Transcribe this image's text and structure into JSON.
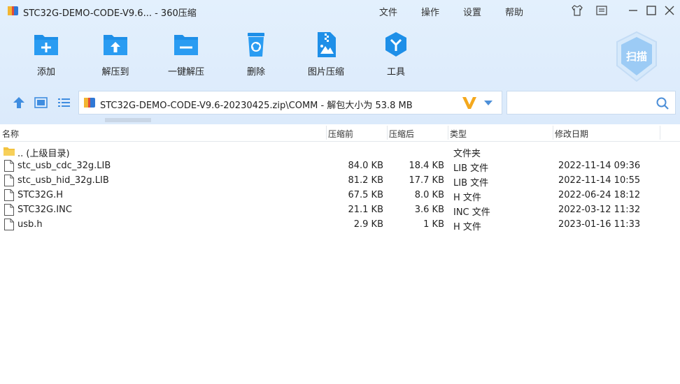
{
  "window": {
    "title": "STC32G-DEMO-CODE-V9.6... - 360压缩",
    "menu": [
      "文件",
      "操作",
      "设置",
      "帮助"
    ]
  },
  "toolbar": {
    "items": [
      {
        "label": "添加",
        "icon": "add-icon"
      },
      {
        "label": "解压到",
        "icon": "extract-to-icon"
      },
      {
        "label": "一键解压",
        "icon": "one-click-extract-icon"
      },
      {
        "label": "删除",
        "icon": "delete-icon"
      },
      {
        "label": "图片压缩",
        "icon": "image-compress-icon"
      },
      {
        "label": "工具",
        "icon": "tools-icon"
      }
    ],
    "scan_label": "扫描"
  },
  "address": {
    "path": "STC32G-DEMO-CODE-V9.6-20230425.zip\\COMM - 解包大小为 53.8 MB"
  },
  "search": {
    "placeholder": ""
  },
  "columns": {
    "name": "名称",
    "compressed_before": "压缩前",
    "compressed_after": "压缩后",
    "type": "类型",
    "modified": "修改日期"
  },
  "files": [
    {
      "name": ".. (上级目录)",
      "before": "",
      "after": "",
      "type": "文件夹",
      "date": "",
      "kind": "folder"
    },
    {
      "name": "stc_usb_cdc_32g.LIB",
      "before": "84.0 KB",
      "after": "18.4 KB",
      "type": "LIB 文件",
      "date": "2022-11-14 09:36",
      "kind": "file"
    },
    {
      "name": "stc_usb_hid_32g.LIB",
      "before": "81.2 KB",
      "after": "17.7 KB",
      "type": "LIB 文件",
      "date": "2022-11-14 10:55",
      "kind": "file"
    },
    {
      "name": "STC32G.H",
      "before": "67.5 KB",
      "after": "8.0 KB",
      "type": "H 文件",
      "date": "2022-06-24 18:12",
      "kind": "file"
    },
    {
      "name": "STC32G.INC",
      "before": "21.1 KB",
      "after": "3.6 KB",
      "type": "INC 文件",
      "date": "2022-03-12 11:32",
      "kind": "file"
    },
    {
      "name": "usb.h",
      "before": "2.9 KB",
      "after": "1 KB",
      "type": "H 文件",
      "date": "2023-01-16 11:33",
      "kind": "file"
    }
  ],
  "colors": {
    "accent": "#1e8fe8",
    "top_bg": "#e3f0fd",
    "folder": "#f3c33f",
    "v_logo": "#f4a81d"
  }
}
